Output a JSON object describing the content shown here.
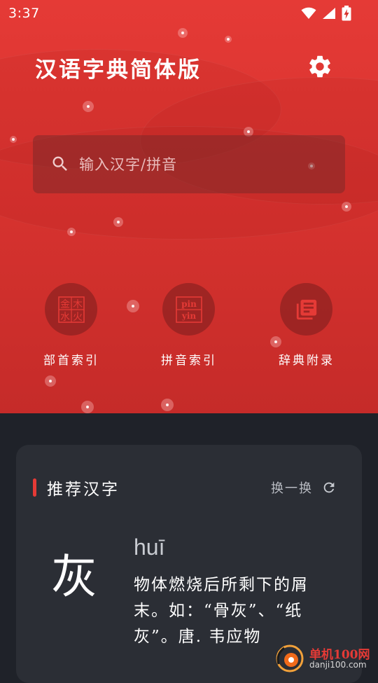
{
  "status_bar": {
    "time": "3:37"
  },
  "header": {
    "title": "汉语字典简体版"
  },
  "search": {
    "placeholder": "输入汉字/拼音"
  },
  "nav": [
    {
      "label": "部首索引",
      "icon": "radical-grid-icon",
      "glyphs": [
        "金",
        "木",
        "水",
        "火"
      ]
    },
    {
      "label": "拼音索引",
      "icon": "pinyin-icon",
      "glyphs": [
        "pin",
        "yin"
      ]
    },
    {
      "label": "辞典附录",
      "icon": "book-list-icon"
    }
  ],
  "recommend": {
    "title": "推荐汉字",
    "refresh_label": "换一换",
    "character": "灰",
    "pinyin": "huī",
    "definition": "物体燃烧后所剩下的屑末。如：“骨灰”、“纸灰”。唐. 韦应物"
  },
  "watermark": {
    "name": "单机100网",
    "url": "danji100.com"
  },
  "colors": {
    "primary": "#e53a36",
    "card_bg": "#2b2e35",
    "page_bg": "#1f2229"
  }
}
